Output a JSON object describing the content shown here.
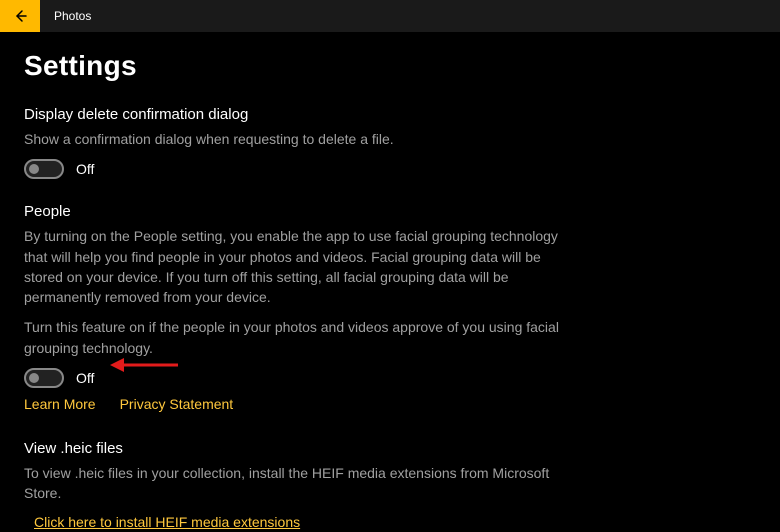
{
  "titlebar": {
    "app_title": "Photos"
  },
  "header": {
    "page_title": "Settings"
  },
  "sections": {
    "delete_confirm": {
      "title": "Display delete confirmation dialog",
      "desc": "Show a confirmation dialog when requesting to delete a file.",
      "toggle_state": "Off"
    },
    "people": {
      "title": "People",
      "desc1": "By turning on the People setting, you enable the app to use facial grouping technology that will help you find people in your photos and videos. Facial grouping data will be stored on your device. If you turn off this setting, all facial grouping data will be permanently removed from your device.",
      "desc2": "Turn this feature on if the people in your photos and videos approve of you using facial grouping technology.",
      "toggle_state": "Off",
      "learn_more": "Learn More",
      "privacy": "Privacy Statement"
    },
    "heic": {
      "title": "View .heic files",
      "desc": "To view .heic files in your collection, install the HEIF media extensions from Microsoft Store.",
      "install_link": "Click here to install HEIF media extensions"
    }
  },
  "colors": {
    "accent": "#ffb900",
    "link": "#ffc83d",
    "muted": "#a0a0a0",
    "annotation": "#e31b1b"
  }
}
